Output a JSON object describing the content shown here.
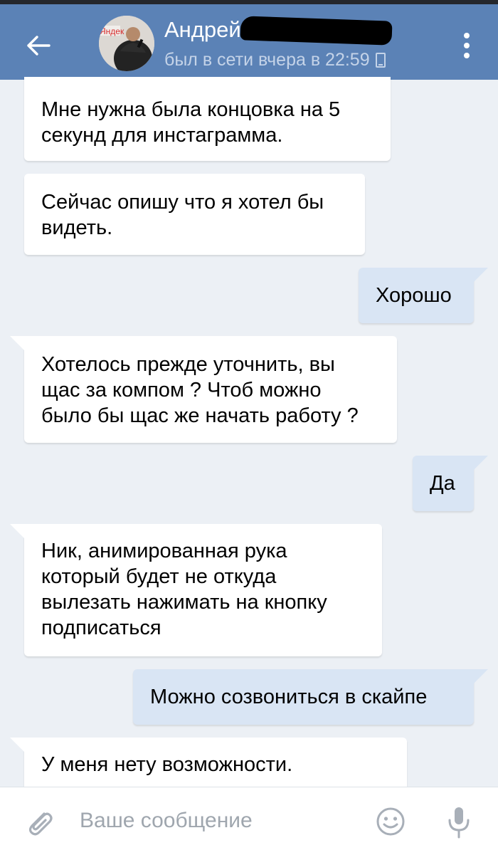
{
  "header": {
    "contact_name": "Андрей",
    "status": "был в сети вчера в 22:59",
    "avatar_text": "Яндек"
  },
  "messages": [
    {
      "side": "in",
      "text": "Мне нужна была концовка на 5\nсекунд для инстаграмма."
    },
    {
      "side": "in",
      "text": "Сейчас опишу что я хотел бы\nвидеть."
    },
    {
      "side": "out",
      "text": "Хорошо"
    },
    {
      "side": "in",
      "text": "Хотелось прежде уточнить, вы\nщас за компом ? Чтоб можно\nбыло бы щас же начать работу ?"
    },
    {
      "side": "out",
      "text": "Да"
    },
    {
      "side": "in",
      "text": "Ник, анимированная рука\nкоторый будет не откуда\nвылезать нажимать на кнопку\nподписаться"
    },
    {
      "side": "out",
      "text": "Можно созвониться в скайпе"
    },
    {
      "side": "in",
      "text": "У меня нету возможности."
    }
  ],
  "composer": {
    "placeholder": "Ваше сообщение"
  },
  "colors": {
    "header_bg": "#5b82b6",
    "chat_bg": "#ecf0f5",
    "incoming_bubble": "#ffffff",
    "outgoing_bubble": "#d9e5f4",
    "icon_gray": "#a8afb8"
  },
  "icons": {
    "back": "arrow-left-icon",
    "menu": "more-vertical-icon",
    "status_device": "mobile-icon",
    "attach": "paperclip-icon",
    "emoji": "smiley-icon",
    "voice": "microphone-icon"
  }
}
